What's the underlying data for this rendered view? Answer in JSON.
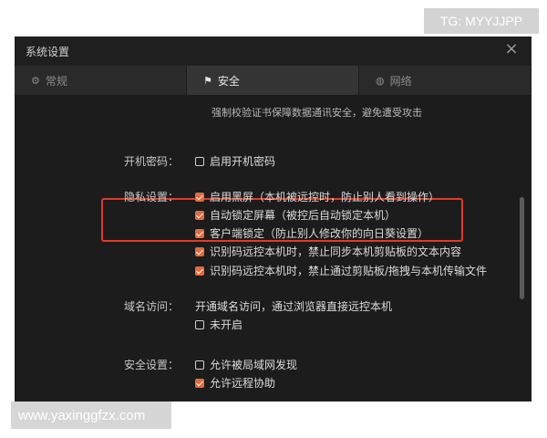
{
  "watermarks": {
    "top": "TG: MYYJJPP",
    "bottom": "www.yaxinggfzx.com"
  },
  "window": {
    "title": "系统设置",
    "close_icon": "×"
  },
  "tabs": [
    {
      "label": "常规",
      "icon": "gear-icon",
      "active": false
    },
    {
      "label": "安全",
      "icon": "shield-icon",
      "active": true
    },
    {
      "label": "网络",
      "icon": "globe-icon",
      "active": false
    }
  ],
  "security": {
    "hint": "强制校验证书保障数据通讯安全，避免遭受攻击",
    "boot_password": {
      "label": "开机密码：",
      "option": {
        "text": "启用开机密码",
        "checked": false
      }
    },
    "privacy": {
      "label": "隐私设置：",
      "options": [
        {
          "text": "启用黑屏（本机被远控时，防止别人看到操作）",
          "checked": true
        },
        {
          "text": "自动锁定屏幕（被控后自动锁定本机）",
          "checked": true
        },
        {
          "text": "客户端锁定（防止别人修改你的向日葵设置）",
          "checked": true
        },
        {
          "text": "识别码远控本机时，禁止同步本机剪贴板的文本内容",
          "checked": true
        },
        {
          "text": "识别码远控本机时，禁止通过剪贴板/拖拽与本机传输文件",
          "checked": true
        }
      ]
    },
    "domain_access": {
      "label": "域名访问：",
      "description": "开通域名访问，通过浏览器直接远控本机",
      "option": {
        "text": "未开启",
        "checked": false
      }
    },
    "safety": {
      "label": "安全设置：",
      "options": [
        {
          "text": "允许被局域网发现",
          "checked": false
        },
        {
          "text": "允许远程协助",
          "checked": true
        }
      ]
    }
  },
  "colors": {
    "accent": "#e46a3e",
    "highlight_border": "#e23a2a",
    "window_bg": "#1c1c1c"
  }
}
